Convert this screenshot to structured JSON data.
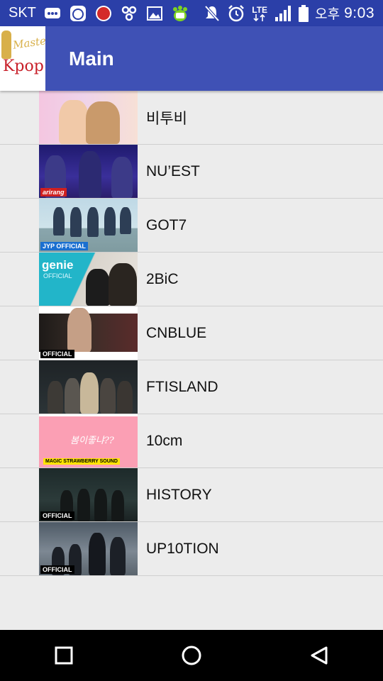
{
  "status_bar": {
    "carrier": "SKT",
    "network": "LTE",
    "ampm": "오후",
    "time": "9:03",
    "icons": [
      "chat-icon",
      "face-app-icon",
      "red-badge-app-icon",
      "share-app-icon",
      "image-icon",
      "paw-app-icon",
      "mute-icon",
      "alarm-icon",
      "lte-icon",
      "signal-icon",
      "battery-icon"
    ]
  },
  "app_bar": {
    "logo_text_top": "Master",
    "logo_text_bottom": "Kpop",
    "title": "Main",
    "color": "#3f51b5"
  },
  "list": [
    {
      "label": "비투비",
      "thumb_badge": ""
    },
    {
      "label": "NU’EST",
      "thumb_badge": "arirang"
    },
    {
      "label": "GOT7",
      "thumb_badge": "JYP OFFICIAL"
    },
    {
      "label": "2BiC",
      "thumb_badge": "genie"
    },
    {
      "label": "CNBLUE",
      "thumb_badge": "OFFICIAL"
    },
    {
      "label": "FTISLAND",
      "thumb_badge": ""
    },
    {
      "label": "10cm",
      "thumb_badge": "MAGIC STRAWBERRY SOUND"
    },
    {
      "label": "HISTORY",
      "thumb_badge": "OFFICIAL"
    },
    {
      "label": "UP10TION",
      "thumb_badge": "OFFICIAL"
    }
  ],
  "thumb_extra": {
    "genie_sub": "OFFICIAL",
    "script_10cm": "봄이좋냐??"
  },
  "nav_bar": {
    "icons": [
      "recents-square-icon",
      "home-circle-icon",
      "back-triangle-icon"
    ]
  }
}
